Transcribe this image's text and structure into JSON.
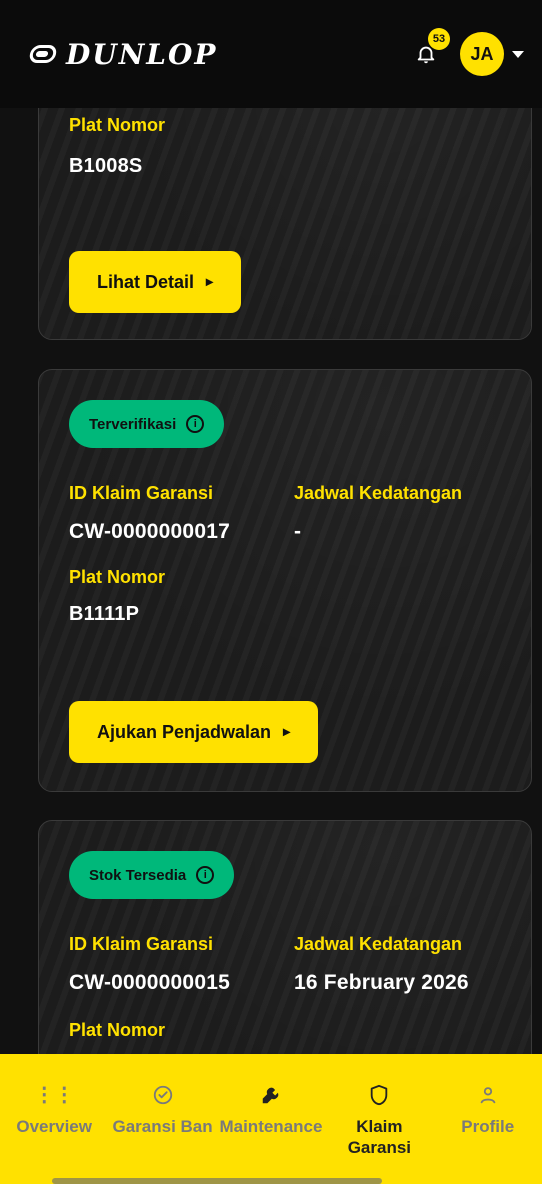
{
  "brand": {
    "logo_text": "DUNLOP"
  },
  "header": {
    "notifications_count": "53",
    "avatar_initials": "JA"
  },
  "cards": [
    {
      "plate_label": "Plat Nomor",
      "plate_value": "B1008S",
      "button_label": "Lihat Detail"
    },
    {
      "status": "Terverifikasi",
      "claim_id_label": "ID Klaim Garansi",
      "claim_id_value": "CW-0000000017",
      "arrival_label": "Jadwal Kedatangan",
      "arrival_value": "-",
      "plate_label": "Plat Nomor",
      "plate_value": "B1111P",
      "button_label": "Ajukan Penjadwalan"
    },
    {
      "status": "Stok Tersedia",
      "claim_id_label": "ID Klaim Garansi",
      "claim_id_value": "CW-0000000015",
      "arrival_label": "Jadwal Kedatangan",
      "arrival_value": "16 February 2026",
      "plate_label": "Plat Nomor"
    }
  ],
  "bottom_nav": [
    {
      "label": "Overview",
      "icon": "grid-icon"
    },
    {
      "label": "Garansi Ban",
      "icon": "check-circle-icon"
    },
    {
      "label": "Maintenance",
      "icon": "wrench-icon"
    },
    {
      "label": "Klaim Garansi",
      "icon": "shield-icon",
      "active": true
    },
    {
      "label": "Profile",
      "icon": "user-icon"
    }
  ],
  "colors": {
    "accent_yellow": "#ffe100",
    "status_green": "#00b87a",
    "background": "#111111"
  }
}
